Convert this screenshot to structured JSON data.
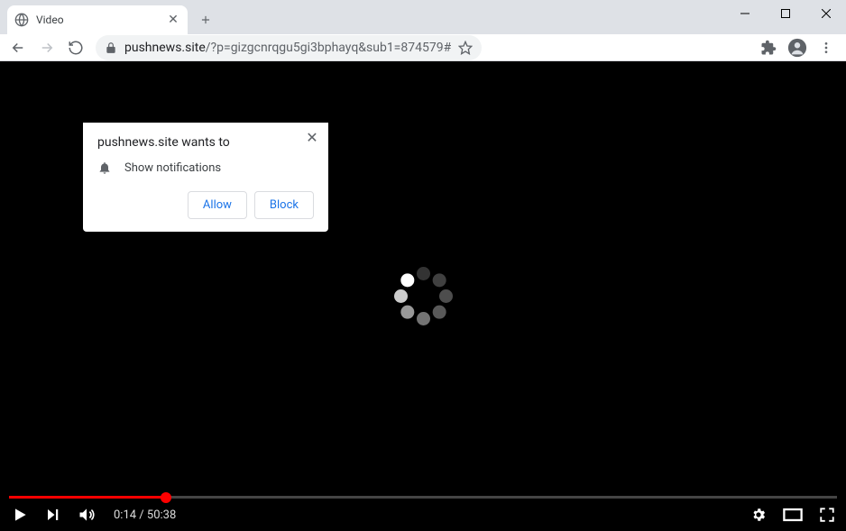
{
  "tab": {
    "title": "Video"
  },
  "url": {
    "host": "pushnews.site",
    "path": "/?p=gizgcnrqgu5gi3bphayq&sub1=874579#"
  },
  "permission": {
    "title": "pushnews.site wants to",
    "item": "Show notifications",
    "allow": "Allow",
    "block": "Block"
  },
  "player": {
    "current": "0:14",
    "sep": " / ",
    "duration": "50:38",
    "progress_pct": 19
  },
  "spinner_dots": [
    {
      "angle": 225,
      "opacity": 1.0
    },
    {
      "angle": 270,
      "opacity": 0.2
    },
    {
      "angle": 315,
      "opacity": 0.25
    },
    {
      "angle": 0,
      "opacity": 0.3
    },
    {
      "angle": 45,
      "opacity": 0.35
    },
    {
      "angle": 90,
      "opacity": 0.45
    },
    {
      "angle": 135,
      "opacity": 0.6
    },
    {
      "angle": 180,
      "opacity": 0.8
    }
  ]
}
